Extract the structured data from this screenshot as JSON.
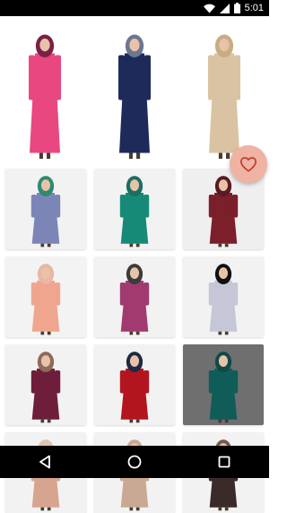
{
  "status_bar": {
    "time": "5:01"
  },
  "hero": {
    "items": [
      {
        "icon": "pink-dress-model-photo",
        "dress_color": "#e9477f",
        "scarf_color": "#7a2048"
      },
      {
        "icon": "navy-coat-model-photo",
        "dress_color": "#1e2a5a",
        "scarf_color": "#6b7690"
      },
      {
        "icon": "beige-dress-model-photo",
        "dress_color": "#d9c3a2",
        "scarf_color": "#c8ad84"
      }
    ]
  },
  "grid": {
    "items": [
      {
        "dress_color": "#7b86b6",
        "scarf_color": "#2f8a6f",
        "bg": "#f2f2f2"
      },
      {
        "dress_color": "#178a77",
        "scarf_color": "#1b6e62",
        "bg": "#f2f2f2"
      },
      {
        "dress_color": "#7b1f2a",
        "scarf_color": "#5b1a22",
        "bg": "#efefef"
      },
      {
        "dress_color": "#f0a58e",
        "scarf_color": "#e8b6a5",
        "bg": "#f3f3f3"
      },
      {
        "dress_color": "#a13a6e",
        "scarf_color": "#3b3b3b",
        "bg": "#f2f2f2"
      },
      {
        "dress_color": "#c5c6d6",
        "scarf_color": "#111111",
        "bg": "#f2f2f2"
      },
      {
        "dress_color": "#6e1e3a",
        "scarf_color": "#8d6a5a",
        "bg": "#f2f2f2"
      },
      {
        "dress_color": "#b3151f",
        "scarf_color": "#1d2a44",
        "bg": "#f2f2f2"
      },
      {
        "dress_color": "#0f5c58",
        "scarf_color": "#0f4a48",
        "bg": "#6f6f6f"
      },
      {
        "dress_color": "#d7a48f",
        "scarf_color": "#e1c2b3",
        "bg": "#f2f2f2"
      },
      {
        "dress_color": "#c9a993",
        "scarf_color": "#c9a993",
        "bg": "#f2f2f2"
      },
      {
        "dress_color": "#3a2a2a",
        "scarf_color": "#7a5a4a",
        "bg": "#f2f2f2"
      }
    ]
  },
  "fab": {
    "icon": "heart-outline-icon",
    "color": "#f0b2a3"
  },
  "nav": {
    "back_icon": "back-triangle-icon",
    "home_icon": "home-circle-icon",
    "recents_icon": "recents-square-icon"
  }
}
